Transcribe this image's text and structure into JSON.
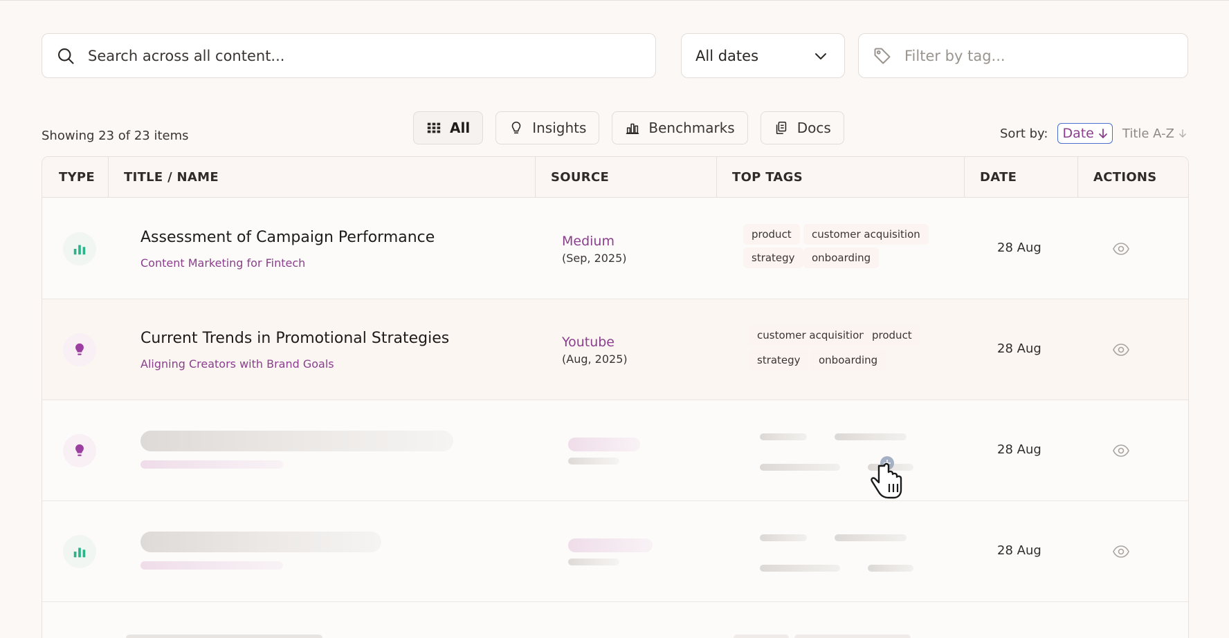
{
  "search": {
    "placeholder": "Search across all content..."
  },
  "date_filter": {
    "selected": "All dates"
  },
  "tag_filter": {
    "placeholder": "Filter by tag..."
  },
  "summary": {
    "showing": "Showing 23 of 23 items"
  },
  "segments": [
    {
      "label": "All",
      "icon": "grid-icon",
      "active": true
    },
    {
      "label": "Insights",
      "icon": "lightbulb-icon",
      "active": false
    },
    {
      "label": "Benchmarks",
      "icon": "bar-chart-icon",
      "active": false
    },
    {
      "label": "Docs",
      "icon": "documents-icon",
      "active": false
    }
  ],
  "sort": {
    "label": "Sort by:",
    "active": "Date",
    "alternative": "Title A-Z"
  },
  "table": {
    "headers": [
      "TYPE",
      "TITLE / NAME",
      "SOURCE",
      "TOP TAGS",
      "DATE",
      "ACTIONS"
    ],
    "rows": [
      {
        "type": "benchmark",
        "title": "Assessment of Campaign Performance",
        "subtitle": "Content Marketing for Fintech",
        "source": "Medium",
        "source_date": "(Sep, 2025)",
        "tags": [
          "product",
          "customer acquisition",
          "strategy",
          "onboarding"
        ],
        "date": "28 Aug"
      },
      {
        "type": "insight",
        "title": "Current Trends in Promotional Strategies",
        "subtitle": "Aligning Creators with Brand Goals",
        "source": "Youtube",
        "source_date": "(Aug, 2025)",
        "tags": [
          "customer acquisition",
          "product",
          "strategy",
          "onboarding"
        ],
        "date": "28 Aug"
      },
      {
        "type": "insight",
        "loading": true,
        "date": "28 Aug"
      },
      {
        "type": "benchmark",
        "loading": true,
        "date": "28 Aug"
      }
    ]
  },
  "colors": {
    "accent_purple": "#8a3f8c",
    "accent_green": "#2bb38a",
    "accent_blue": "#4a6fd1"
  }
}
